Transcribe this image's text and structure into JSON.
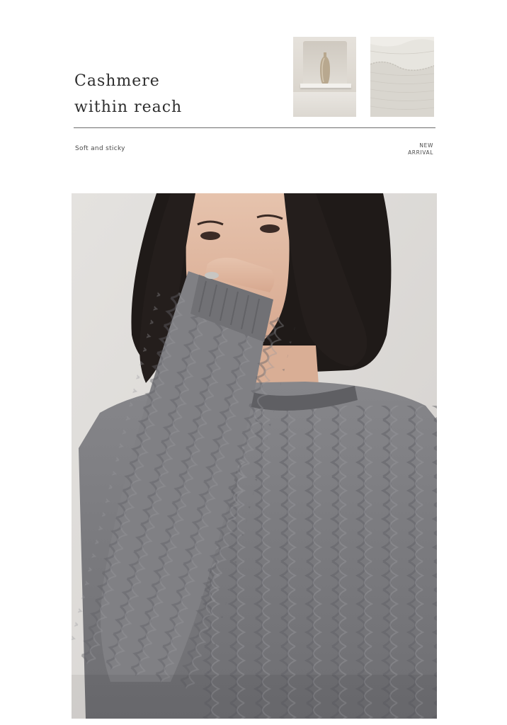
{
  "header": {
    "title_line1": "Cashmere",
    "title_line2": "within reach"
  },
  "tagline": "Soft and sticky",
  "badge": {
    "line1": "NEW",
    "line2": "ARRIVAL"
  },
  "images": {
    "thumbnail_1": "vase-on-shelf",
    "thumbnail_2": "knit-fabric",
    "hero": "woman-in-grey-cable-knit-sweater"
  },
  "colors": {
    "text": "#3a3a3a",
    "rule": "#6d6d6d",
    "sweater": "#7b7b7e",
    "hair": "#1f1a18",
    "backdrop": "#dedbd8"
  }
}
